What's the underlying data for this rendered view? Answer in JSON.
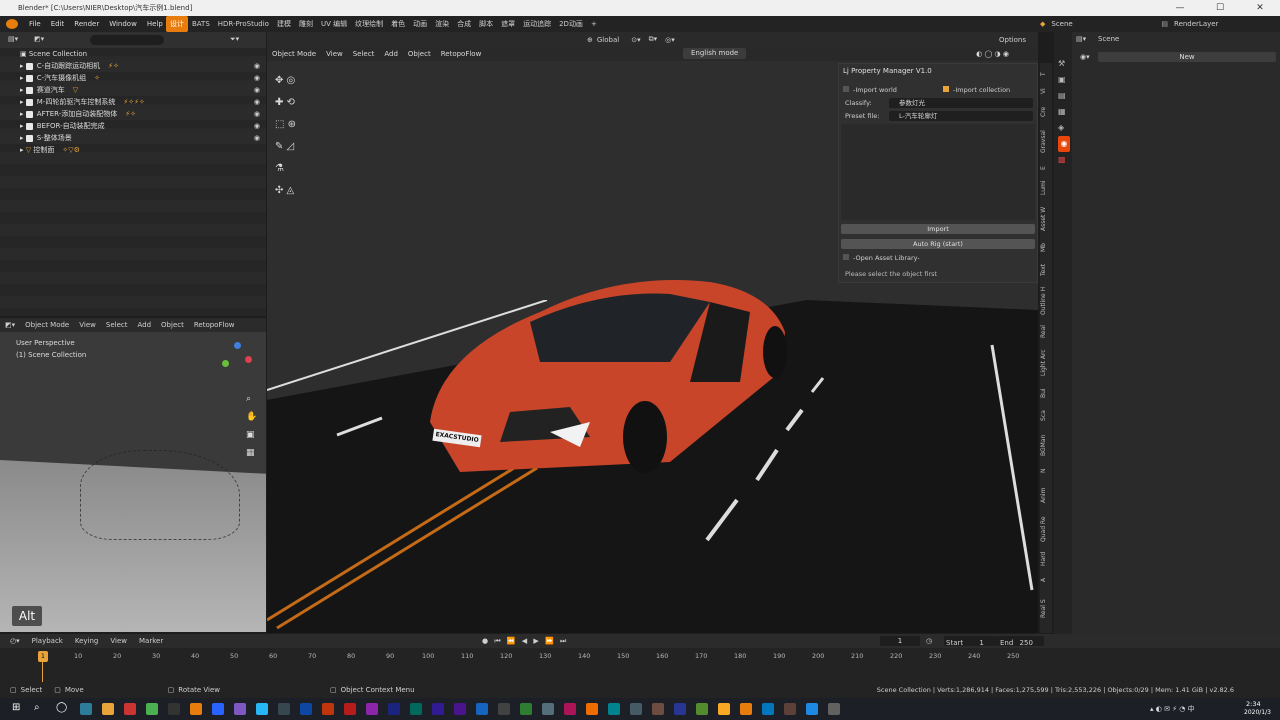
{
  "window": {
    "title": "Blender* [C:\\Users\\NIER\\Desktop\\汽车示例1.blend]"
  },
  "menubar": {
    "menus": [
      "File",
      "Edit",
      "Render",
      "Window",
      "Help"
    ],
    "workspaces": [
      "设计",
      "BATS",
      "HDR-ProStudio",
      "建模",
      "雕刻",
      "UV 编辑",
      "纹理绘制",
      "着色",
      "动画",
      "渲染",
      "合成",
      "脚本",
      "遮罩",
      "运动追踪",
      "2D动画",
      "+"
    ],
    "scene_label": "Scene",
    "view_layer": "RenderLayer"
  },
  "outliner": {
    "root": "Scene Collection",
    "rows": [
      {
        "label": "C-自动跟踪运动相机"
      },
      {
        "label": "C-汽车摄像机组"
      },
      {
        "label": "赛道汽车"
      },
      {
        "label": "M-四轮前驱汽车控制系统"
      },
      {
        "label": "AFTER-添加自动装配物体"
      },
      {
        "label": "BEFOR-自动装配完成"
      },
      {
        "label": "S-整体场景"
      },
      {
        "label": "控制面"
      }
    ]
  },
  "mini_viewport": {
    "header": [
      "Object Mode",
      "View",
      "Select",
      "Add",
      "Object",
      "RetopoFlow"
    ],
    "overlay_line1": "User Perspective",
    "overlay_line2": "(1) Scene Collection",
    "alt_badge": "Alt"
  },
  "main_viewport": {
    "top": {
      "transform": "Global",
      "options": "Options"
    },
    "header": [
      "Object Mode",
      "View",
      "Select",
      "Add",
      "Object",
      "RetopoFlow"
    ],
    "lang_button": "English mode",
    "plate": "EXACSTUDIO"
  },
  "panel": {
    "title": "Lj Property Manager V1.0",
    "import_world": "-Import world",
    "import_collection": "-Import collection",
    "classify_label": "Classify:",
    "classify_value": "参数灯光",
    "preset_label": "Preset file:",
    "preset_value": "L-汽车轮廓灯",
    "import_btn": "Import",
    "autorig_btn": "Auto Rig (start)",
    "open_library": "-Open Asset Library-",
    "hint": "Please select the object first"
  },
  "side_tabs": [
    "Real S",
    "A",
    "Hard",
    "Quad Re",
    "Anim",
    "N",
    "BGMan",
    "Sca",
    "Bui",
    "Light Arc",
    "Real",
    "Outline H",
    "Text",
    "Mb",
    "Asset W",
    "Lumi",
    "E",
    "Gravsal",
    "Cre",
    "Vi",
    "T"
  ],
  "properties": {
    "scene": "Scene",
    "new_button": "New"
  },
  "timeline": {
    "menus": [
      "Playback",
      "Keying",
      "View",
      "Marker"
    ],
    "current": "1",
    "start_label": "Start",
    "start": "1",
    "end_label": "End",
    "end": "250",
    "ticks": [
      "10",
      "20",
      "30",
      "40",
      "50",
      "60",
      "70",
      "80",
      "90",
      "100",
      "110",
      "120",
      "130",
      "140",
      "150",
      "160",
      "170",
      "180",
      "190",
      "200",
      "210",
      "220",
      "230",
      "240",
      "250"
    ],
    "playhead": "1"
  },
  "status": {
    "select": "Select",
    "move": "Move",
    "rotate": "Rotate View",
    "context": "Object Context Menu",
    "stats": "Scene Collection | Verts:1,286,914 | Faces:1,275,599 | Tris:2,553,226 | Objects:0/29 | Mem: 1.41 GiB | v2.82.6"
  },
  "taskbar": {
    "time": "2:34",
    "date": "2020/1/3"
  },
  "colors": {
    "accent": "#e87d0d",
    "car": "#c8452a"
  }
}
